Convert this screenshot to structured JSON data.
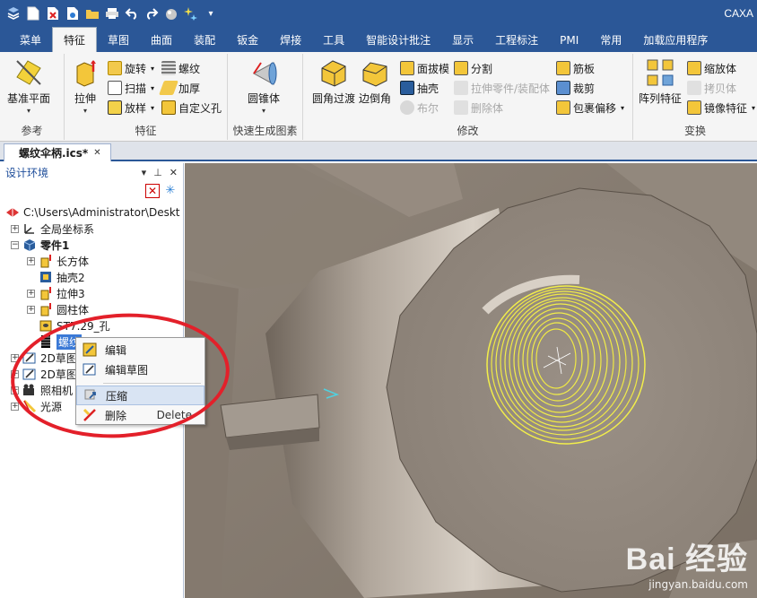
{
  "app": {
    "title": "CAXA"
  },
  "quick_access": {
    "icons": [
      "app-menu-icon",
      "new-icon",
      "close-doc-icon",
      "save-icon",
      "open-folder-icon",
      "print-icon",
      "undo-icon",
      "redo-icon",
      "material-icon",
      "sparkle-icon",
      "dropdown-icon"
    ]
  },
  "ribbon_tabs": [
    {
      "label": "菜单",
      "active": false
    },
    {
      "label": "特征",
      "active": true
    },
    {
      "label": "草图",
      "active": false
    },
    {
      "label": "曲面",
      "active": false
    },
    {
      "label": "装配",
      "active": false
    },
    {
      "label": "钣金",
      "active": false
    },
    {
      "label": "焊接",
      "active": false
    },
    {
      "label": "工具",
      "active": false
    },
    {
      "label": "智能设计批注",
      "active": false
    },
    {
      "label": "显示",
      "active": false
    },
    {
      "label": "工程标注",
      "active": false
    },
    {
      "label": "PMI",
      "active": false
    },
    {
      "label": "常用",
      "active": false
    },
    {
      "label": "加载应用程序",
      "active": false
    }
  ],
  "ribbon": {
    "groups": {
      "reference": "参考",
      "feature": "特征",
      "quick_gen": "快速生成图素",
      "modify": "修改",
      "transform": "变换"
    },
    "buttons": {
      "datum_plane": "基准平面",
      "extrude": "拉伸",
      "revolve": "旋转",
      "sweep": "扫描",
      "loft": "放样",
      "thread": "螺纹",
      "thicken": "加厚",
      "custom_hole": "自定义孔",
      "cone": "圆锥体",
      "fillet": "圆角过渡",
      "chamfer": "边倒角",
      "draft": "面拔模",
      "shell": "抽壳",
      "boolean": "布尔",
      "split": "分割",
      "extrude_part": "拉伸零件/装配体",
      "delete_body": "删除体",
      "rib": "筋板",
      "trim": "裁剪",
      "wrap_offset": "包裹偏移",
      "pattern": "阵列特征",
      "scale": "缩放体",
      "copy_body": "拷贝体",
      "mirror": "镜像特征"
    }
  },
  "document_tab": {
    "label": "螺纹伞柄.ics*"
  },
  "panel": {
    "title": "设计环境",
    "tree": [
      {
        "label": "C:\\Users\\Administrator\\Deskt"
      },
      {
        "label": "全局坐标系"
      },
      {
        "label": "零件1"
      },
      {
        "label": "长方体"
      },
      {
        "label": "抽壳2"
      },
      {
        "label": "拉伸3"
      },
      {
        "label": "圆柱体"
      },
      {
        "label": "ST7.29_孔"
      },
      {
        "label": "螺纹"
      },
      {
        "label": "2D草图"
      },
      {
        "label": "2D草图"
      },
      {
        "label": "照相机"
      },
      {
        "label": "光源"
      }
    ]
  },
  "context_menu": {
    "items": [
      {
        "label": "编辑",
        "shortcut": ""
      },
      {
        "label": "编辑草图",
        "shortcut": ""
      },
      {
        "label": "压缩",
        "shortcut": ""
      },
      {
        "label": "删除",
        "shortcut": "Delete"
      }
    ]
  },
  "watermark": {
    "logo": "Bai 经验",
    "url": "jingyan.baidu.com"
  },
  "colors": {
    "title_blue": "#2b5797",
    "ribbon_bg": "#f5f5f5",
    "viewport_bg": "#7e7468",
    "thread_yellow": "#f2ee4a",
    "highlight_red": "#e3202a",
    "selection_blue": "#3a79d6"
  }
}
